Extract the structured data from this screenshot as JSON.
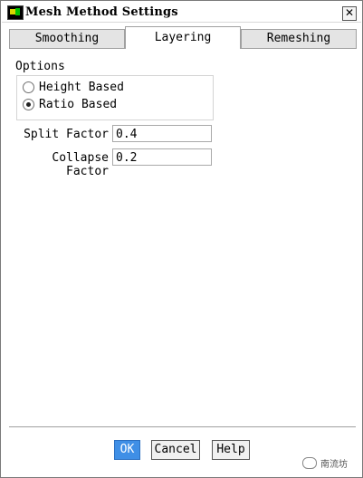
{
  "window": {
    "title": "Mesh Method Settings",
    "close_glyph": "✕"
  },
  "tabs": [
    {
      "label": "Smoothing",
      "active": false
    },
    {
      "label": "Layering",
      "active": true
    },
    {
      "label": "Remeshing",
      "active": false
    }
  ],
  "options": {
    "label": "Options",
    "radios": [
      {
        "label": "Height Based",
        "checked": false
      },
      {
        "label": "Ratio Based",
        "checked": true
      }
    ]
  },
  "fields": {
    "split_factor": {
      "label": "Split Factor",
      "value": "0.4"
    },
    "collapse_factor": {
      "label": "Collapse Factor",
      "value": "0.2"
    }
  },
  "buttons": {
    "ok": "OK",
    "cancel": "Cancel",
    "help": "Help"
  },
  "watermark": {
    "text": "南流坊"
  },
  "colors": {
    "accent": "#3f8fe6"
  }
}
